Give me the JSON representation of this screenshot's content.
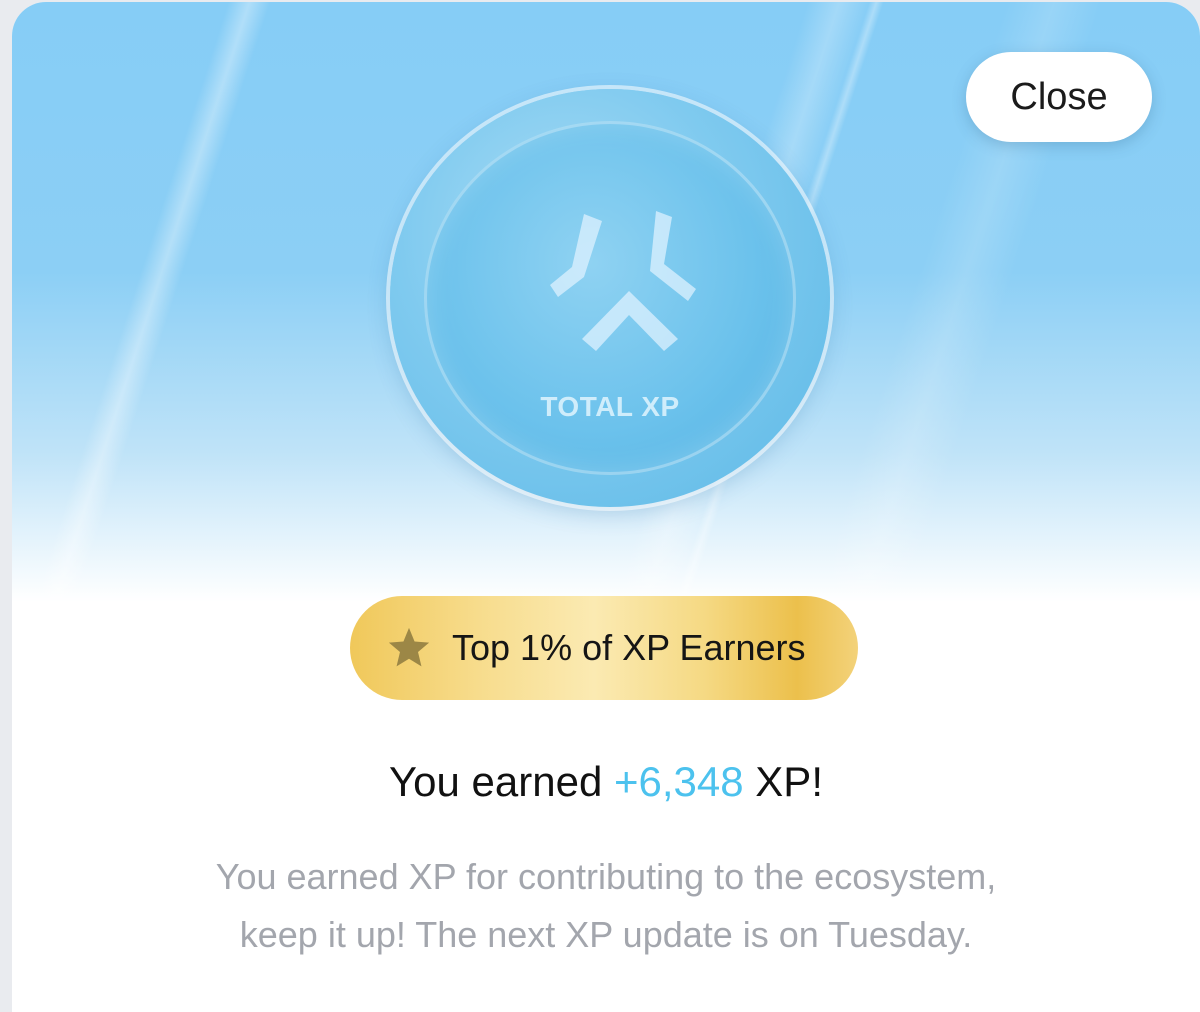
{
  "header": {
    "close_label": "Close"
  },
  "coin": {
    "label": "TOTAL XP",
    "logo_icon": "xp-logo-icon"
  },
  "badge": {
    "icon": "star-icon",
    "label": "Top 1% of XP Earners"
  },
  "result": {
    "prefix": "You earned",
    "amount": "+6,348",
    "suffix": "XP!"
  },
  "description": {
    "line1": "You earned XP for contributing to the ecosystem,",
    "line2": "keep it up! The next XP update is on Tuesday."
  },
  "colors": {
    "accent": "#4cc2ee",
    "hero_top": "#86cdf6",
    "badge_gold": "#f0c85a",
    "muted_text": "#a3a6ad"
  }
}
